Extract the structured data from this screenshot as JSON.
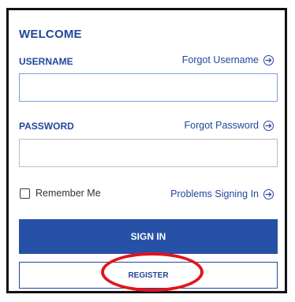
{
  "form": {
    "title": "WELCOME",
    "username": {
      "label": "USERNAME",
      "value": "",
      "forgot_link": "Forgot Username"
    },
    "password": {
      "label": "PASSWORD",
      "value": "",
      "forgot_link": "Forgot Password"
    },
    "remember_me": {
      "label": "Remember Me",
      "checked": false
    },
    "problems_link": "Problems Signing In",
    "signin_label": "SIGN IN",
    "register_label": "REGISTER"
  },
  "colors": {
    "brand_blue": "#2651a6",
    "text_blue": "#23479a",
    "highlight_red": "#e1141d"
  },
  "annotation": {
    "type": "red-ellipse-highlight",
    "target": "register-button"
  }
}
